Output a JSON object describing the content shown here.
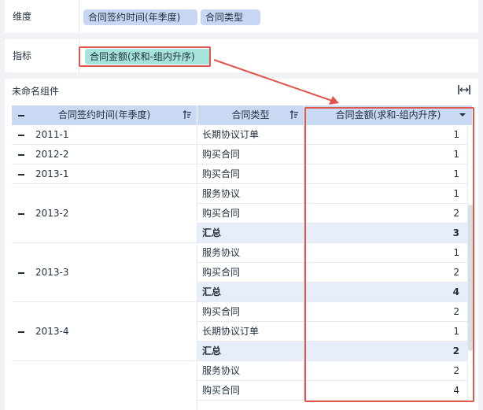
{
  "dimension_row": {
    "label": "维度",
    "pills": [
      "合同签约时间(年季度)",
      "合同类型"
    ]
  },
  "metric_row": {
    "label": "指标",
    "pills": [
      "合同金额(求和-组内升序)"
    ]
  },
  "component": {
    "title": "未命名组件",
    "fit_icon": "fit-width-icon"
  },
  "table": {
    "headers": [
      {
        "label": "合同签约时间(年季度)",
        "icon": "sort-icon"
      },
      {
        "label": "合同类型",
        "icon": "sort-icon"
      },
      {
        "label": "合同金额(求和-组内升序)",
        "icon": "dropdown-caret-icon"
      }
    ],
    "groups": [
      {
        "period": "2011-1",
        "rows": [
          {
            "type": "长期协议订单",
            "value": "1",
            "summary": false
          }
        ]
      },
      {
        "period": "2012-2",
        "rows": [
          {
            "type": "购买合同",
            "value": "1",
            "summary": false
          }
        ]
      },
      {
        "period": "2013-1",
        "rows": [
          {
            "type": "购买合同",
            "value": "1",
            "summary": false
          }
        ]
      },
      {
        "period": "2013-2",
        "rows": [
          {
            "type": "服务协议",
            "value": "1",
            "summary": false
          },
          {
            "type": "购买合同",
            "value": "2",
            "summary": false
          },
          {
            "type": "汇总",
            "value": "3",
            "summary": true
          }
        ]
      },
      {
        "period": "2013-3",
        "rows": [
          {
            "type": "服务协议",
            "value": "1",
            "summary": false
          },
          {
            "type": "购买合同",
            "value": "2",
            "summary": false
          },
          {
            "type": "汇总",
            "value": "4",
            "summary": true
          }
        ]
      },
      {
        "period": "2013-4",
        "rows": [
          {
            "type": "购买合同",
            "value": "2",
            "summary": false
          },
          {
            "type": "长期协议订单",
            "value": "1",
            "summary": false
          },
          {
            "type": "汇总",
            "value": "2",
            "summary": true
          }
        ]
      },
      {
        "period": "",
        "rows": [
          {
            "type": "服务协议",
            "value": "2",
            "summary": false
          },
          {
            "type": "购买合同",
            "value": "4",
            "summary": false
          }
        ]
      }
    ]
  },
  "colors": {
    "highlight": "#e2554a",
    "header_bg": "#c9d9f3",
    "dim_pill": "#c7d6f2",
    "metric_pill": "#a6e3da",
    "summary_bg": "#e8eef9"
  }
}
